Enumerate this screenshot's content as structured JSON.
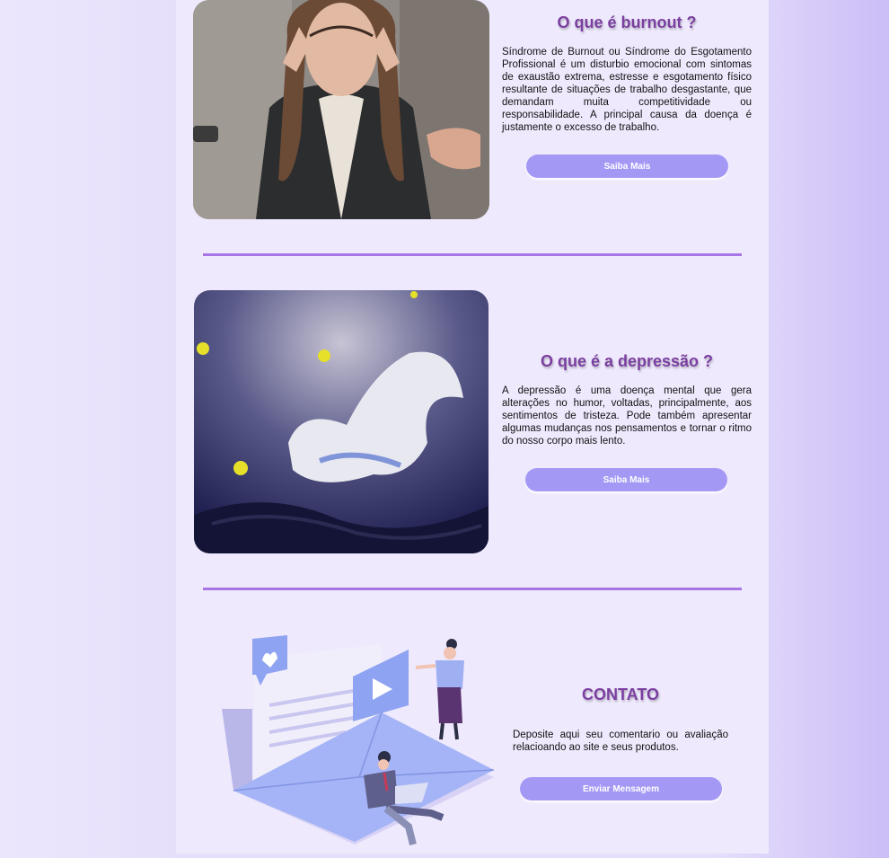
{
  "burnout": {
    "title": "O que é burnout ?",
    "text": "Síndrome de Burnout ou Síndrome do Esgotamento Profissional é um disturbio emocional com sintomas de exaustão extrema, estresse e esgotamento físico resultante de situações de trabalho desgastante, que demandam muita competitividade ou responsabilidade. A principal causa da doença é justamente o excesso de trabalho.",
    "button": "Saiba Mais"
  },
  "depressao": {
    "title": "O que é a depressão ?",
    "text": "A depressão é uma doença mental que gera alterações no humor, voltadas, principalmente, aos sentimentos de tristeza. Pode também apresentar algumas mudanças nos pensamentos e tornar o ritmo do nosso corpo mais lento.",
    "button": "Saiba Mais"
  },
  "contato": {
    "title": "CONTATO",
    "text": "Deposite aqui seu comentario ou avaliação relacioando ao site e seus produtos.",
    "button": "Enviar Mensagem"
  }
}
